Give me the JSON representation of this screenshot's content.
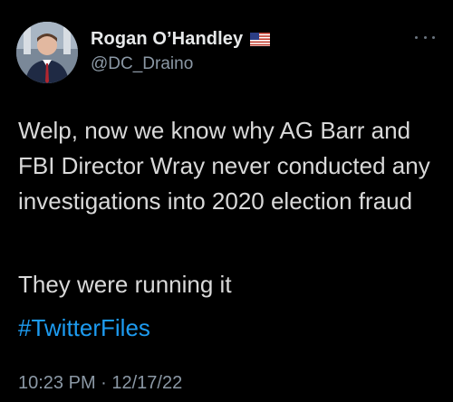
{
  "tweet": {
    "author": {
      "display_name": "Rogan O’Handley",
      "badge_icon": "us-flag-icon",
      "handle": "@DC_Draino",
      "avatar_icon": "avatar"
    },
    "menu_icon": "more-options-icon",
    "body": "Welp, now we know why AG Barr and FBI Director Wray never conducted any investigations into 2020 election fraud",
    "second_line": "They were running it",
    "hashtag": "#TwitterFiles",
    "timestamp": "10:23 PM · 12/17/22"
  },
  "colors": {
    "background": "#000000",
    "text": "#d9d9d9",
    "secondary": "#8b98a5",
    "link": "#1d9bf0"
  }
}
